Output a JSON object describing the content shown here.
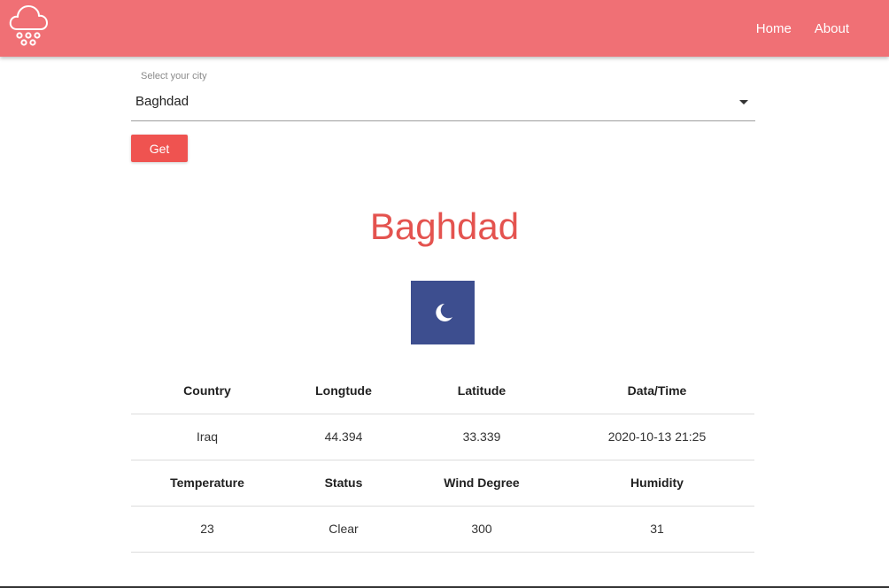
{
  "nav": {
    "logo_icon": "cloud-rain-icon",
    "links": [
      "Home",
      "About"
    ],
    "background": "#f07075"
  },
  "form": {
    "select_label": "Select your city",
    "selected_city": "Baghdad",
    "get_button": "Get",
    "button_color": "#ef5350"
  },
  "result": {
    "city": "Baghdad",
    "title_color": "#e4534f",
    "weather_icon": "moon-icon",
    "icon_background": "#3d4e8f",
    "table": {
      "row1_headers": [
        "Country",
        "Longtude",
        "Latitude",
        "Data/Time"
      ],
      "row1_values": [
        "Iraq",
        "44.394",
        "33.339",
        "2020-10-13 21:25"
      ],
      "row2_headers": [
        "Temperature",
        "Status",
        "Wind Degree",
        "Humidity"
      ],
      "row2_values": [
        "23",
        "Clear",
        "300",
        "31"
      ]
    }
  }
}
